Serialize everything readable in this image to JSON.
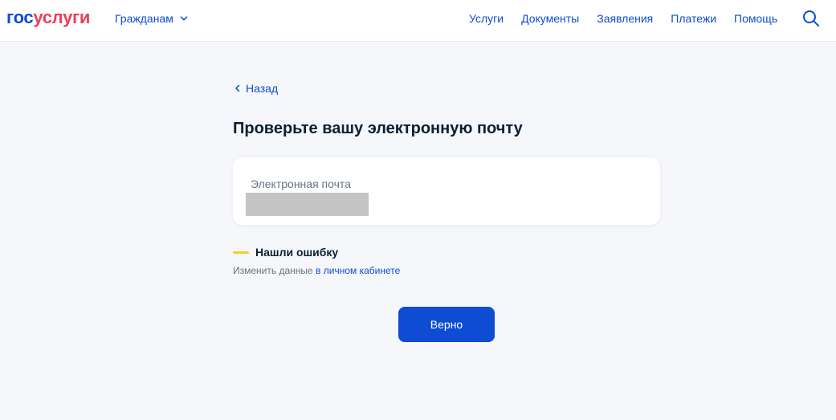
{
  "header": {
    "logo": {
      "part1": "гос",
      "part2": "услуги"
    },
    "audience": {
      "label": "Гражданам",
      "icon": "chevron-down-icon"
    },
    "nav": [
      "Услуги",
      "Документы",
      "Заявления",
      "Платежи",
      "Помощь"
    ],
    "search_icon": "search-icon"
  },
  "main": {
    "back": {
      "label": "Назад",
      "icon": "chevron-left-icon"
    },
    "title": "Проверьте вашу электронную почту",
    "email_card": {
      "label": "Электронная почта",
      "value": ""
    },
    "error": {
      "heading": "Нашли ошибку",
      "text": "Изменить данные ",
      "link": "в личном кабинете"
    },
    "confirm_button": "Верно"
  },
  "colors": {
    "primary": "#0d4cd3",
    "logo_red": "#ee3f58",
    "warning_bar": "#f5cb3a",
    "background": "#f5f7fa",
    "text": "#0b1f33",
    "muted": "#66727f",
    "redacted": "#c4c4c4"
  }
}
